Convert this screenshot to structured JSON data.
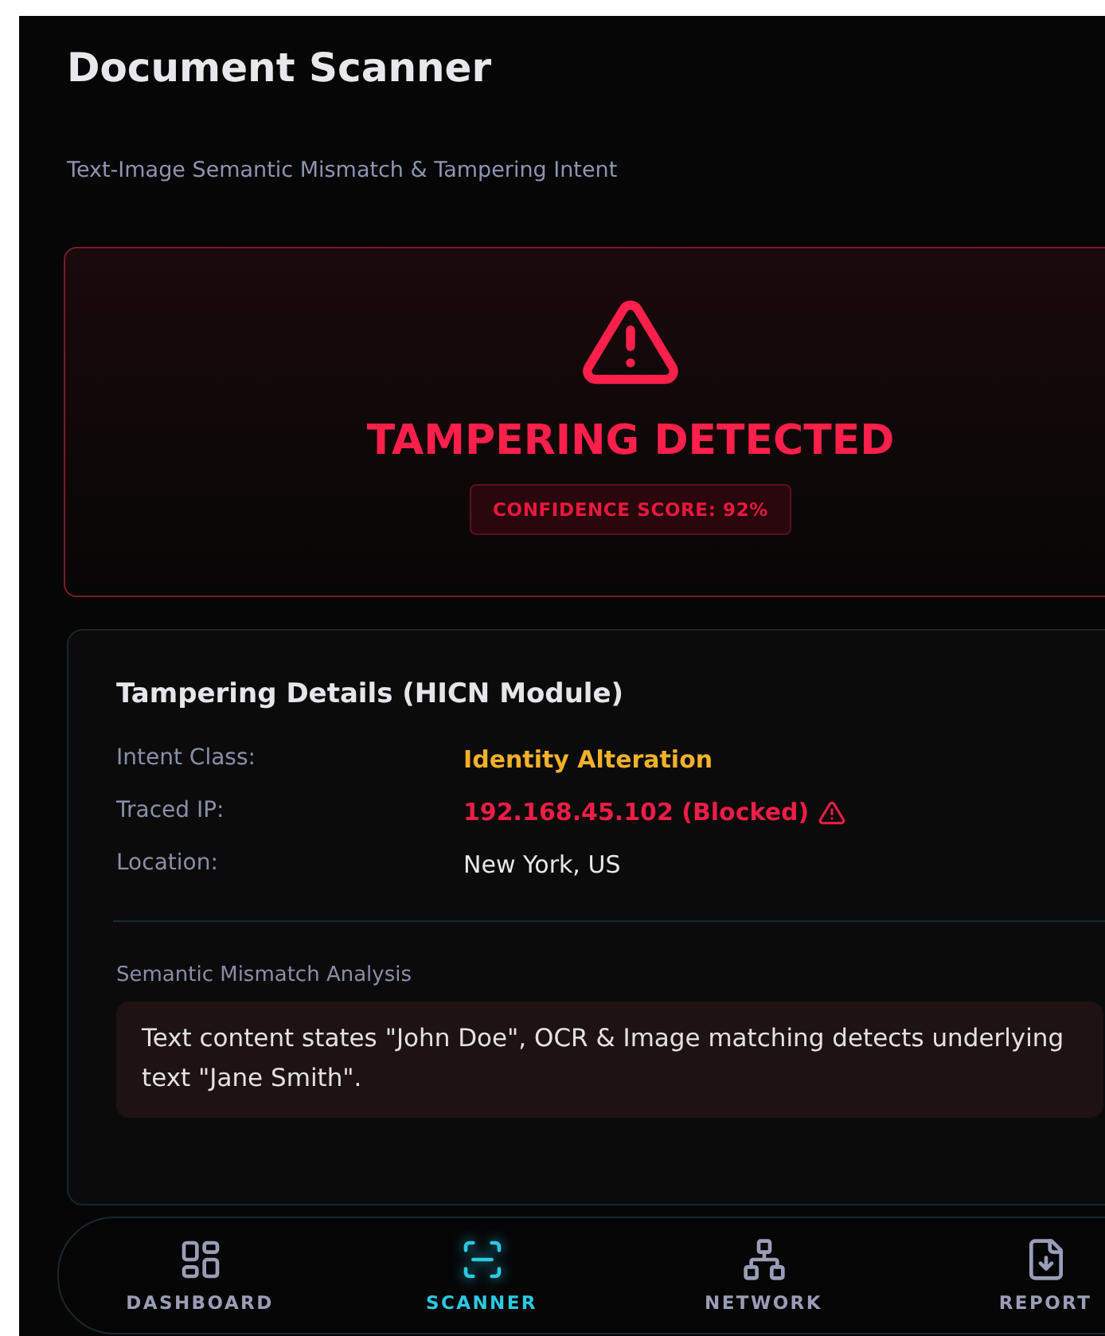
{
  "header": {
    "title": "Document Scanner",
    "subtitle": "Text-Image Semantic Mismatch & Tampering Intent"
  },
  "alert": {
    "title": "TAMPERING DETECTED",
    "badge": "CONFIDENCE SCORE: 92%"
  },
  "details": {
    "title": "Tampering Details (HICN Module)",
    "rows": [
      {
        "label": "Intent Class:",
        "value": "Identity Alteration",
        "kind": "warning"
      },
      {
        "label": "Traced IP:",
        "value": "192.168.45.102 (Blocked)",
        "kind": "danger"
      },
      {
        "label": "Location:",
        "value": "New York, US",
        "kind": "plain"
      }
    ],
    "analysis_label": "Semantic Mismatch Analysis",
    "analysis_text": "Text content states \"John Doe\", OCR & Image matching detects underlying text \"Jane Smith\"."
  },
  "nav": [
    {
      "label": "DASHBOARD",
      "selected": false
    },
    {
      "label": "SCANNER",
      "selected": true
    },
    {
      "label": "NETWORK",
      "selected": false
    },
    {
      "label": "REPORT",
      "selected": false
    }
  ]
}
